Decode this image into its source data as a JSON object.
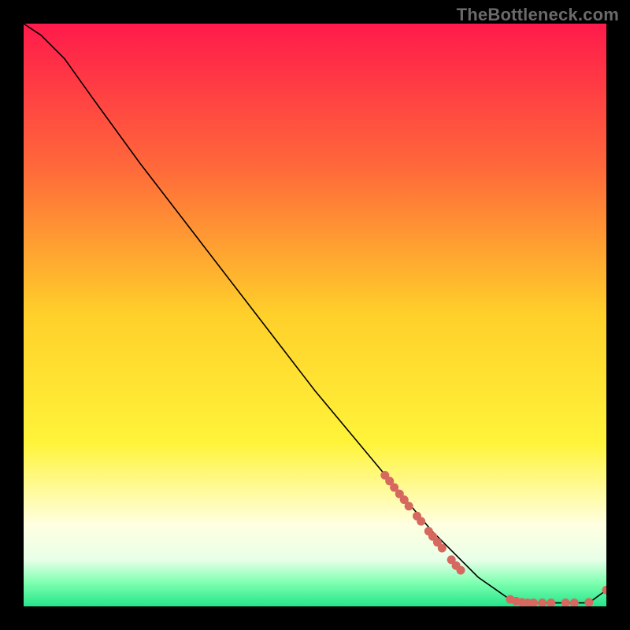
{
  "attribution": "TheBottleneck.com",
  "chart_data": {
    "type": "line",
    "title": "",
    "xlabel": "",
    "ylabel": "",
    "xlim": [
      0,
      100
    ],
    "ylim": [
      0,
      100
    ],
    "grid": false,
    "legend": false,
    "background_gradient": {
      "stops": [
        {
          "t": 0.0,
          "color": "#ff1a4b"
        },
        {
          "t": 0.25,
          "color": "#ff6a3a"
        },
        {
          "t": 0.5,
          "color": "#ffd02a"
        },
        {
          "t": 0.72,
          "color": "#fff43a"
        },
        {
          "t": 0.86,
          "color": "#ffffe1"
        },
        {
          "t": 0.92,
          "color": "#e8ffe8"
        },
        {
          "t": 0.96,
          "color": "#7dffb0"
        },
        {
          "t": 1.0,
          "color": "#25e58a"
        }
      ]
    },
    "curve": [
      {
        "x": 0.0,
        "y": 100.0
      },
      {
        "x": 3.0,
        "y": 98.0
      },
      {
        "x": 7.0,
        "y": 94.0
      },
      {
        "x": 12.0,
        "y": 87.0
      },
      {
        "x": 20.0,
        "y": 76.0
      },
      {
        "x": 30.0,
        "y": 63.0
      },
      {
        "x": 40.0,
        "y": 50.0
      },
      {
        "x": 50.0,
        "y": 37.0
      },
      {
        "x": 60.0,
        "y": 25.0
      },
      {
        "x": 70.0,
        "y": 13.0
      },
      {
        "x": 78.0,
        "y": 5.0
      },
      {
        "x": 83.0,
        "y": 1.5
      },
      {
        "x": 86.0,
        "y": 0.6
      },
      {
        "x": 92.0,
        "y": 0.6
      },
      {
        "x": 97.0,
        "y": 0.6
      },
      {
        "x": 100.0,
        "y": 2.8
      }
    ],
    "marker_color": "#d6695f",
    "line_color": "#000000",
    "markers": [
      {
        "x": 62.0,
        "y": 22.5
      },
      {
        "x": 62.8,
        "y": 21.5
      },
      {
        "x": 63.6,
        "y": 20.4
      },
      {
        "x": 64.5,
        "y": 19.3
      },
      {
        "x": 65.3,
        "y": 18.3
      },
      {
        "x": 66.1,
        "y": 17.2
      },
      {
        "x": 67.5,
        "y": 15.5
      },
      {
        "x": 68.2,
        "y": 14.6
      },
      {
        "x": 69.5,
        "y": 12.9
      },
      {
        "x": 70.2,
        "y": 12.0
      },
      {
        "x": 71.0,
        "y": 11.0
      },
      {
        "x": 71.8,
        "y": 10.0
      },
      {
        "x": 73.4,
        "y": 8.0
      },
      {
        "x": 74.2,
        "y": 7.0
      },
      {
        "x": 75.0,
        "y": 6.2
      },
      {
        "x": 83.5,
        "y": 1.2
      },
      {
        "x": 84.5,
        "y": 0.9
      },
      {
        "x": 85.5,
        "y": 0.7
      },
      {
        "x": 86.5,
        "y": 0.6
      },
      {
        "x": 87.5,
        "y": 0.6
      },
      {
        "x": 89.0,
        "y": 0.6
      },
      {
        "x": 90.5,
        "y": 0.6
      },
      {
        "x": 93.0,
        "y": 0.6
      },
      {
        "x": 94.5,
        "y": 0.6
      },
      {
        "x": 97.0,
        "y": 0.7
      },
      {
        "x": 100.0,
        "y": 2.8
      }
    ]
  }
}
